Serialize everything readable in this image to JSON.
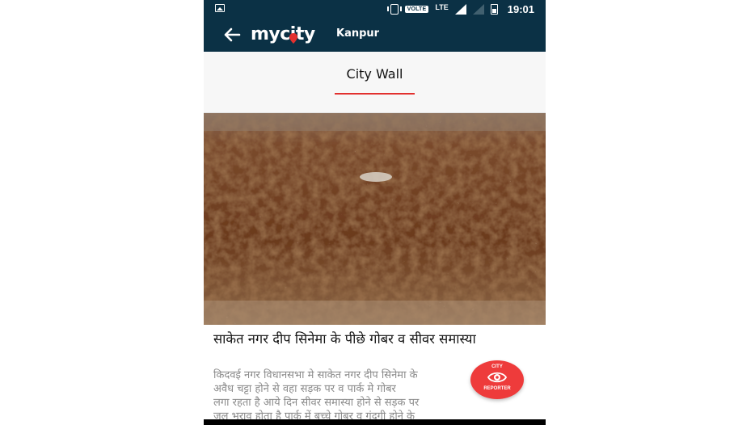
{
  "status_bar": {
    "volte": "VOLTE",
    "network": "LTE",
    "time": "19:01"
  },
  "app_bar": {
    "logo_prefix": "my",
    "logo_suffix": "city",
    "city": "Kanpur",
    "back_icon": "arrow-left-icon"
  },
  "tab": {
    "label": "City Wall"
  },
  "post": {
    "image_desc": "photo",
    "headline": "साकेत नगर दीप  सिनेमा के पीछे गोबर व सीवर समास्या",
    "body_lines": [
      "किदवई नगर विधानसभा मे साकेत नगर दीप सिनेमा के",
      "अवैध चट्टा  होने  से  वहा सड़क पर व पार्क मे गोबर",
      "लगा रहता  है आये दिन सीवर समास्या होने से सड़क  पर",
      "जल भराव  होता है पार्क में बच्चे  गोबर व  गंदगी होने  के"
    ]
  },
  "fab": {
    "top": "CITY",
    "bottom": "REPORTER",
    "icon": "eye-icon"
  },
  "colors": {
    "primary": "#0b3145",
    "accent": "#e2312f"
  }
}
